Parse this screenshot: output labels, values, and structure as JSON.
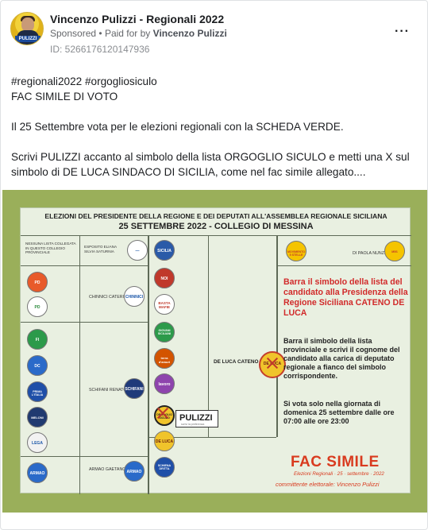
{
  "header": {
    "page_name": "Vincenzo Pulizzi - Regionali 2022",
    "sponsored": "Sponsored",
    "paid_for_by": "Paid for by",
    "sponsor_name": "Vincenzo Pulizzi",
    "ad_id": "ID: 5266176120147936",
    "more_icon": "more-icon",
    "avatar_label": "PULIZZI"
  },
  "post": {
    "line1": "#regionali2022 #orgogliosiculo",
    "line2": "FAC SIMILE DI VOTO",
    "line3": "Il 25 Settembre vota per le elezioni regionali con la SCHEDA VERDE.",
    "line4": "Scrivi PULIZZI accanto al simbolo della lista ORGOGLIO SICULO e metti una X sul simbolo di DE LUCA SINDACO DI SICILIA, come nel fac simile allegato...."
  },
  "ballot": {
    "title1": "ELEZIONI DEL PRESIDENTE DELLA REGIONE E DEI DEPUTATI ALL'ASSEMBLEA REGIONALE SICILIANA",
    "title2": "25 SETTEMBRE 2022 - COLLEGIO DI MESSINA",
    "cell_no_list": "NESSUNA LISTA COLLEGATA IN QUESTO COLLEGIO PROVINCIALE",
    "cand_esposito": "ESPOSITO ELIANA SILVIA SATURNIA",
    "cand_chinnici": "CHINNICI CATERINA",
    "cand_schifani": "SCHIFANI RENATO",
    "cand_armao": "ARMAO GAETANO",
    "cand_deluca": "DE LUCA CATENO",
    "cand_lanuzzo": "DI PAOLA NUNZIO",
    "pulizzi_name": "PULIZZI",
    "pulizzi_sub": "scrivi la preferenza",
    "instr_title": "Barra il simbolo della lista del candidato alla Presidenza della Regione Siciliana CATENO DE LUCA",
    "instr_body": "Barra il simbolo della lista provinciale e scrivi il cognome del candidato alla carica di deputato regionale a fianco del simbolo corrispondente.",
    "instr_vote": "Si vota solo nella giornata di domenica 25 settembre dalle ore 07:00 alle ore 23:00",
    "fac_simile": "FAC SIMILE",
    "fac_sub": "Elezioni Regionali · 25 · settembre · 2022",
    "committee": "committente elettorale: Vincenzo Pulizzi",
    "symbols_left": [
      "PD",
      "PD",
      "FI",
      "DC",
      "PRIMA L'ITALIA",
      "MELONI",
      "LEGA",
      "ARMAO"
    ],
    "symbols_mid": [
      "SICILIA",
      "NOI",
      "BASTA MAFIE",
      "GIOVANI SICILIANI",
      "terra d'amuri",
      "lavoro",
      "ORGOGLIO SICULO",
      "DE LUCA",
      "SCHIENA DRITTA"
    ],
    "logo_m5s": "MOVIMENTO 5 STELLE"
  },
  "colors": {
    "ad_bg": "#9aaf5a",
    "ballot_bg": "#e9f0e1",
    "accent_red": "#d12a2a"
  }
}
